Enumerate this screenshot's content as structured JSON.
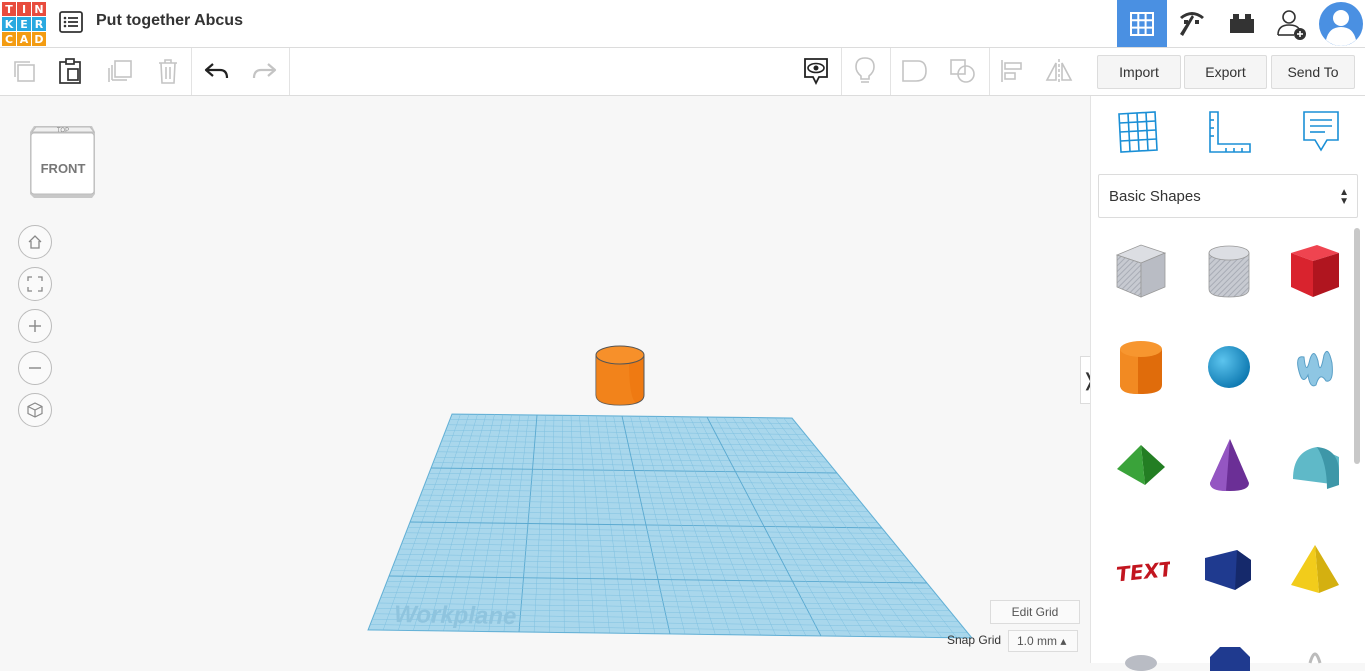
{
  "app": {
    "logo_letters": [
      "T",
      "I",
      "N",
      "K",
      "E",
      "R",
      "C",
      "A",
      "D"
    ],
    "logo_colors": [
      "#e84c3d",
      "#e84c3d",
      "#e84c3d",
      "#2aa9e0",
      "#2aa9e0",
      "#2aa9e0",
      "#f39c12",
      "#f39c12",
      "#f39c12"
    ],
    "project_title": "Put together Abcus",
    "accent_color": "#4a90e2"
  },
  "top_nav": {
    "items": [
      {
        "name": "grid-view-icon",
        "active": true
      },
      {
        "name": "pickaxe-icon",
        "active": false
      },
      {
        "name": "brick-icon",
        "active": false
      },
      {
        "name": "add-user-icon",
        "active": false
      },
      {
        "name": "avatar-icon",
        "active": false
      }
    ]
  },
  "toolbar": {
    "copy_icon": "copy-icon",
    "paste_icon": "paste-icon",
    "duplicate_icon": "duplicate-icon",
    "delete_icon": "trash-icon",
    "undo_icon": "undo-icon",
    "redo_icon": "redo-icon",
    "import_label": "Import",
    "export_label": "Export",
    "send_to_label": "Send To"
  },
  "viewcube": {
    "top_label": "TOP",
    "front_label": "FRONT"
  },
  "workplane": {
    "label": "Workplane"
  },
  "grid": {
    "edit_grid_label": "Edit Grid",
    "snap_grid_label": "Snap Grid",
    "snap_value": "1.0 mm ▴"
  },
  "panel": {
    "toggle_glyph": "❭",
    "shape_category": "Basic Shapes",
    "shapes": [
      {
        "name": "box-hole",
        "color": "#b9bcc4"
      },
      {
        "name": "cylinder-hole",
        "color": "#b9bcc4"
      },
      {
        "name": "box",
        "color": "#d9232e"
      },
      {
        "name": "cylinder",
        "color": "#f07c12"
      },
      {
        "name": "sphere",
        "color": "#1a9fd8"
      },
      {
        "name": "scribble",
        "color": "#7bb6d9"
      },
      {
        "name": "roof",
        "color": "#3aa33a"
      },
      {
        "name": "cone",
        "color": "#7b3fa3"
      },
      {
        "name": "round-roof",
        "color": "#5fb9c8"
      },
      {
        "name": "text",
        "color": "#d9232e"
      },
      {
        "name": "wedge",
        "color": "#1f3a8f"
      },
      {
        "name": "pyramid",
        "color": "#f2cc1b"
      }
    ]
  }
}
